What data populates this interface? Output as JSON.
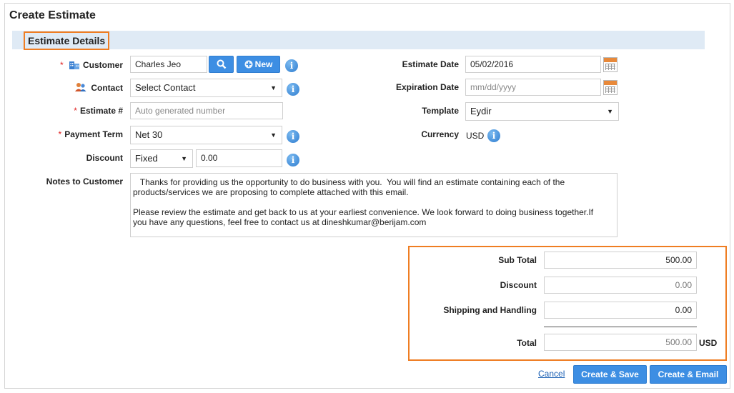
{
  "page": {
    "title": "Create Estimate"
  },
  "section": {
    "title": "Estimate Details"
  },
  "customer": {
    "label": "Customer",
    "value": "Charles Jeo",
    "new_label": "New",
    "info": "i"
  },
  "contact": {
    "label": "Contact",
    "value": "Select Contact",
    "info": "i"
  },
  "estimate_no": {
    "label": "Estimate #",
    "placeholder": "Auto generated number"
  },
  "payment_term": {
    "label": "Payment Term",
    "value": "Net 30",
    "info": "i"
  },
  "discount": {
    "label": "Discount",
    "type": "Fixed",
    "value": "0.00",
    "info": "i"
  },
  "estimate_date": {
    "label": "Estimate Date",
    "value": "05/02/2016"
  },
  "expiration_date": {
    "label": "Expiration Date",
    "placeholder": "mm/dd/yyyy"
  },
  "template": {
    "label": "Template",
    "value": "Eydir"
  },
  "currency": {
    "label": "Currency",
    "value": "USD",
    "info": "i"
  },
  "notes": {
    "label": "Notes to Customer",
    "line1": "   Thanks for providing us the opportunity to do business with you.  You will find an estimate containing each of the",
    "line2": "products/services we are proposing to complete attached with this email.",
    "line3": "Please review the estimate and get back to us at your earliest convenience.  We look forward to doing business together.If",
    "line4": "you have any questions, feel free to contact us at dineshkumar@berijam.com"
  },
  "totals": {
    "subtotal_label": "Sub Total",
    "subtotal_value": "500.00",
    "discount_label": "Discount",
    "discount_value": "0.00",
    "shipping_label": "Shipping and Handling",
    "shipping_value": "0.00",
    "total_label": "Total",
    "total_value": "500.00",
    "currency": "USD"
  },
  "actions": {
    "cancel": "Cancel",
    "create_save": "Create & Save",
    "create_email": "Create & Email"
  },
  "colors": {
    "accent": "#3d8ee3",
    "highlight": "#ef7d22",
    "section_bg": "#dfeaf5",
    "required": "#e02020"
  }
}
